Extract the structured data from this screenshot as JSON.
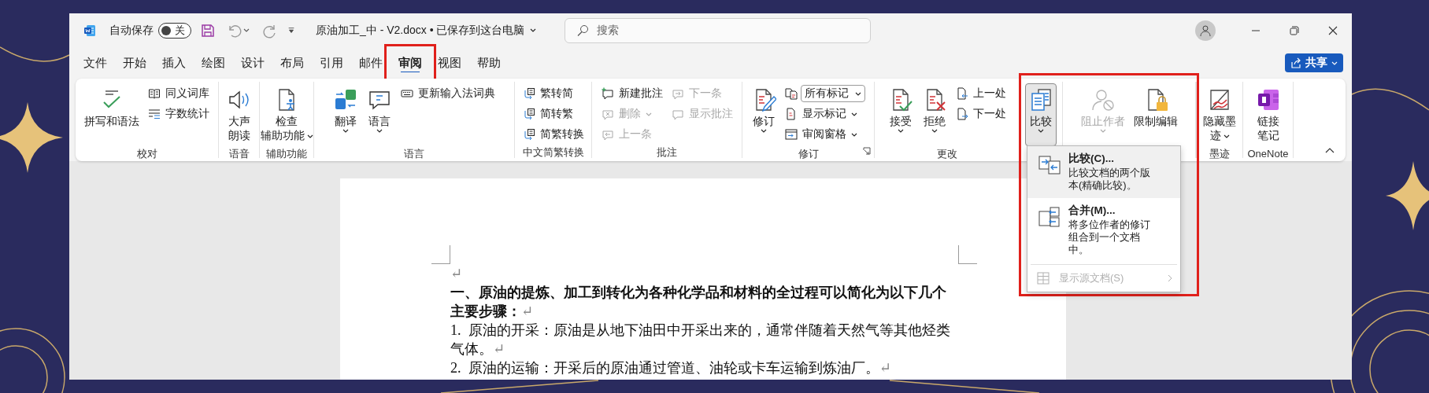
{
  "title_bar": {
    "autosave_label": "自动保存",
    "autosave": {
      "on": false,
      "label": "关"
    },
    "document_title": "原油加工_中 - V2.docx • 已保存到这台电脑",
    "search": {
      "placeholder": "搜索"
    }
  },
  "menu_tabs": [
    {
      "label": "文件",
      "selected": false,
      "highlighted": false
    },
    {
      "label": "开始",
      "selected": false,
      "highlighted": false
    },
    {
      "label": "插入",
      "selected": false,
      "highlighted": false
    },
    {
      "label": "绘图",
      "selected": false,
      "highlighted": false
    },
    {
      "label": "设计",
      "selected": false,
      "highlighted": false
    },
    {
      "label": "布局",
      "selected": false,
      "highlighted": false
    },
    {
      "label": "引用",
      "selected": false,
      "highlighted": false
    },
    {
      "label": "邮件",
      "selected": false,
      "highlighted": false
    },
    {
      "label": "审阅",
      "selected": true,
      "highlighted": true
    },
    {
      "label": "视图",
      "selected": false,
      "highlighted": false
    },
    {
      "label": "帮助",
      "selected": false,
      "highlighted": false
    }
  ],
  "share_button": "共享",
  "ribbon": {
    "groups": [
      {
        "label": "校对",
        "items": [
          {
            "kind": "large",
            "label": "拼写和语法",
            "menu": false,
            "disabled": false,
            "expanded": false
          },
          {
            "kind": "stack",
            "items": [
              {
                "kind": "small",
                "label": "同义词库",
                "menu": false,
                "disabled": false
              },
              {
                "kind": "small",
                "label": "字数统计",
                "menu": false,
                "disabled": false
              }
            ]
          }
        ]
      },
      {
        "label": "语音",
        "items": [
          {
            "kind": "large",
            "lines": [
              "大声",
              "朗读"
            ],
            "menu": false,
            "disabled": false,
            "expanded": false
          }
        ]
      },
      {
        "label": "辅助功能",
        "items": [
          {
            "kind": "large",
            "lines": [
              "检查",
              "辅助功能"
            ],
            "menu": true,
            "disabled": false,
            "expanded": false
          }
        ]
      },
      {
        "label": "语言",
        "items": [
          {
            "kind": "large",
            "label": "翻译",
            "menu": true,
            "disabled": false,
            "expanded": false
          },
          {
            "kind": "large",
            "label": "语言",
            "menu": true,
            "disabled": false,
            "expanded": false
          },
          {
            "kind": "stack",
            "items": [
              {
                "kind": "small",
                "label": "更新输入法词典",
                "menu": false,
                "disabled": false
              }
            ]
          }
        ]
      },
      {
        "label": "中文简繁转换",
        "items": [
          {
            "kind": "stack",
            "items": [
              {
                "kind": "small",
                "label": "繁转简",
                "menu": false,
                "disabled": false
              },
              {
                "kind": "small",
                "label": "简转繁",
                "menu": false,
                "disabled": false
              },
              {
                "kind": "small",
                "label": "简繁转换",
                "menu": false,
                "disabled": false
              }
            ]
          }
        ]
      },
      {
        "label": "批注",
        "items": [
          {
            "kind": "stack",
            "items": [
              {
                "kind": "small",
                "label": "新建批注",
                "menu": false,
                "disabled": false
              },
              {
                "kind": "small",
                "label": "删除",
                "menu": true,
                "disabled": true
              },
              {
                "kind": "small",
                "label": "上一条",
                "menu": false,
                "disabled": true
              }
            ]
          },
          {
            "kind": "stack",
            "items": [
              {
                "kind": "small",
                "label": "下一条",
                "menu": false,
                "disabled": true
              },
              {
                "kind": "small",
                "label": "显示批注",
                "menu": false,
                "disabled": true
              }
            ]
          }
        ]
      },
      {
        "label": "修订",
        "launcher": true,
        "items": [
          {
            "kind": "large",
            "label": "修订",
            "menu": true,
            "disabled": false,
            "expanded": false
          },
          {
            "kind": "stack",
            "items": [
              {
                "kind": "select",
                "value": "所有标记"
              },
              {
                "kind": "small",
                "label": "显示标记",
                "menu": true,
                "disabled": false
              },
              {
                "kind": "small",
                "label": "审阅窗格",
                "menu": true,
                "disabled": false
              }
            ]
          }
        ]
      },
      {
        "label": "更改",
        "items": [
          {
            "kind": "large",
            "label": "接受",
            "menu": true,
            "disabled": false,
            "expanded": false
          },
          {
            "kind": "large",
            "label": "拒绝",
            "menu": true,
            "disabled": false,
            "expanded": false
          },
          {
            "kind": "stack",
            "items": [
              {
                "kind": "small",
                "label": "上一处",
                "menu": false,
                "disabled": false
              },
              {
                "kind": "small",
                "label": "下一处",
                "menu": false,
                "disabled": false
              }
            ]
          }
        ]
      },
      {
        "items": [
          {
            "kind": "large",
            "label": "比较",
            "menu": true,
            "disabled": false,
            "expanded": true
          }
        ]
      },
      {
        "items": [
          {
            "kind": "large",
            "label": "阻止作者",
            "menu": true,
            "disabled": true,
            "expanded": false
          },
          {
            "kind": "large",
            "label": "限制编辑",
            "menu": false,
            "disabled": false,
            "expanded": false
          }
        ]
      },
      {
        "label": "墨迹",
        "items": [
          {
            "kind": "large",
            "lines": [
              "隐藏墨",
              "迹"
            ],
            "menu": true,
            "disabled": false,
            "expanded": false
          }
        ]
      },
      {
        "label": "OneNote",
        "items": [
          {
            "kind": "large",
            "lines": [
              "链接",
              "笔记"
            ],
            "menu": false,
            "disabled": false,
            "expanded": false
          }
        ]
      }
    ]
  },
  "compare_menu": {
    "highlighted": true,
    "items": [
      {
        "kind": "command",
        "title": "比较(C)...",
        "description": "比较文档的两个版本(精确比较)。",
        "selected": true,
        "disabled": false
      },
      {
        "kind": "command",
        "title": "合并(M)...",
        "description": "将多位作者的修订组合到一个文档中。",
        "selected": false,
        "disabled": false
      },
      {
        "kind": "submenu",
        "title": "显示源文档(S)",
        "selected": false,
        "disabled": true
      }
    ]
  },
  "document": {
    "paragraphs": [
      {
        "mark": "↵"
      },
      {
        "text": "一、原油的提炼、加工到转化为各种化学品和材料的全过程可以简化为以下几个主要步骤：",
        "mark": "↵",
        "bold": true
      },
      {
        "text": "1.  原油的开采：原油是从地下油田中开采出来的，通常伴随着天然气等其他烃类气体。",
        "mark": "↵",
        "bold": false
      },
      {
        "text": "2.  原油的运输：开采后的原油通过管道、油轮或卡车运输到炼油厂。",
        "mark": "↵",
        "bold": false
      }
    ]
  }
}
